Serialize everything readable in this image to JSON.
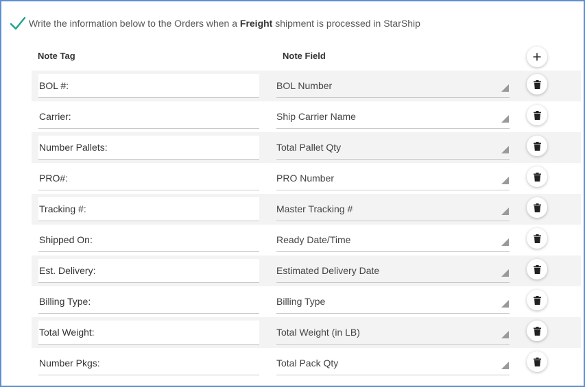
{
  "header": {
    "prefix": "Write the information below to the Orders when a ",
    "bold": "Freight",
    "suffix": " shipment is processed in StarShip"
  },
  "columns": {
    "tag": "Note Tag",
    "field": "Note Field"
  },
  "icons": {
    "check": "checkmark-icon",
    "add": "plus-icon",
    "delete": "trash-icon"
  },
  "colors": {
    "check": "#1aa38a",
    "border": "#5b8fd1",
    "shaded_row": "#f3f3f3"
  },
  "rows": [
    {
      "tag": "BOL #:",
      "field": "BOL Number"
    },
    {
      "tag": "Carrier:",
      "field": "Ship Carrier Name"
    },
    {
      "tag": "Number Pallets:",
      "field": "Total Pallet Qty"
    },
    {
      "tag": "PRO#:",
      "field": "PRO Number"
    },
    {
      "tag": "Tracking #:",
      "field": "Master Tracking #"
    },
    {
      "tag": "Shipped On:",
      "field": "Ready Date/Time"
    },
    {
      "tag": "Est. Delivery:",
      "field": "Estimated Delivery Date"
    },
    {
      "tag": "Billing Type:",
      "field": "Billing Type"
    },
    {
      "tag": "Total Weight:",
      "field": "Total Weight (in LB)"
    },
    {
      "tag": "Number Pkgs:",
      "field": "Total Pack Qty"
    }
  ]
}
